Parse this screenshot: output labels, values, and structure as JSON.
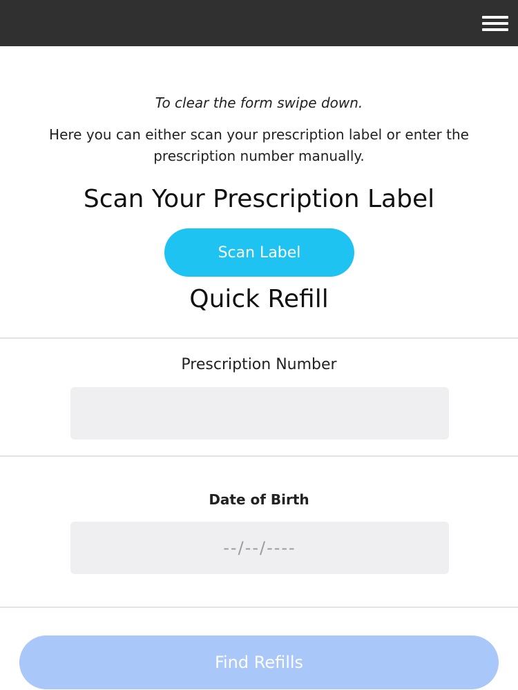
{
  "header": {
    "menu_icon": "hamburger-menu-icon"
  },
  "instructions": {
    "hint": "To clear the form swipe down.",
    "intro": "Here you can either scan your prescription label or enter the prescription number manually."
  },
  "scan": {
    "heading": "Scan Your Prescription Label",
    "button_label": "Scan Label"
  },
  "refill": {
    "heading": "Quick Refill",
    "prescription_label": "Prescription Number",
    "prescription_value": "",
    "dob_label": "Date of Birth",
    "dob_placeholder": "--/--/----",
    "submit_label": "Find Refills"
  },
  "colors": {
    "topbar": "#313031",
    "scan_button": "#1ec3f2",
    "find_button_disabled": "#a9c7f8",
    "input_background": "#efeef1"
  }
}
